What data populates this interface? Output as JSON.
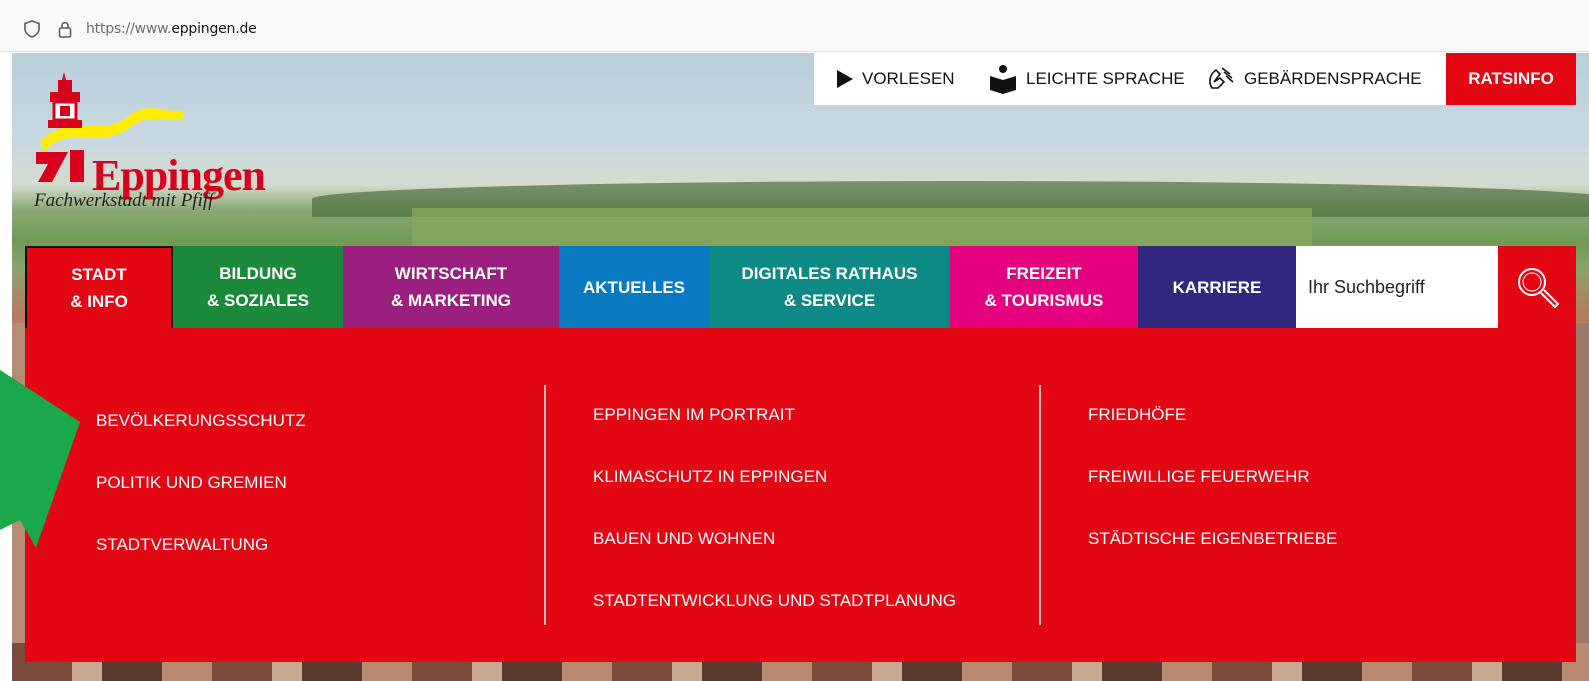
{
  "browser": {
    "url_prefix": "https://www.",
    "url_domain": "eppingen.de"
  },
  "logo": {
    "name": "Eppingen",
    "tagline": "Fachwerkstadt mit Pfiff"
  },
  "utility": {
    "read_aloud": "VORLESEN",
    "easy_language": "LEICHTE SPRACHE",
    "sign_language": "GEBÄRDENSPRACHE",
    "ratsinfo": "RATSINFO"
  },
  "nav": {
    "items": [
      {
        "label": "STADT\n& INFO",
        "color": "#e30613"
      },
      {
        "label": "BILDUNG\n& SOZIALES",
        "color": "#1a8a3a"
      },
      {
        "label": "WIRTSCHAFT\n& MARKETING",
        "color": "#9b1f7e"
      },
      {
        "label": "AKTUELLES",
        "color": "#0a7bc2"
      },
      {
        "label": "DIGITALES RATHAUS\n& SERVICE",
        "color": "#0d8a86"
      },
      {
        "label": "FREIZEIT\n& TOURISMUS",
        "color": "#e5007d"
      },
      {
        "label": "KARRIERE",
        "color": "#30277f"
      }
    ],
    "search_placeholder": "Ihr Suchbegriff"
  },
  "dropdown": {
    "columns": [
      [
        "BEVÖLKERUNGSSCHUTZ",
        "POLITIK UND GREMIEN",
        "STADTVERWALTUNG"
      ],
      [
        "EPPINGEN IM PORTRAIT",
        "KLIMASCHUTZ IN EPPINGEN",
        "BAUEN UND WOHNEN",
        "STADTENTWICKLUNG UND STADTPLANUNG"
      ],
      [
        "FRIEDHÖFE",
        "FREIWILLIGE FEUERWEHR",
        "STÄDTISCHE EIGENBETRIEBE"
      ]
    ]
  },
  "colors": {
    "brand_red": "#e30613",
    "arrow_green": "#1aa84a"
  }
}
